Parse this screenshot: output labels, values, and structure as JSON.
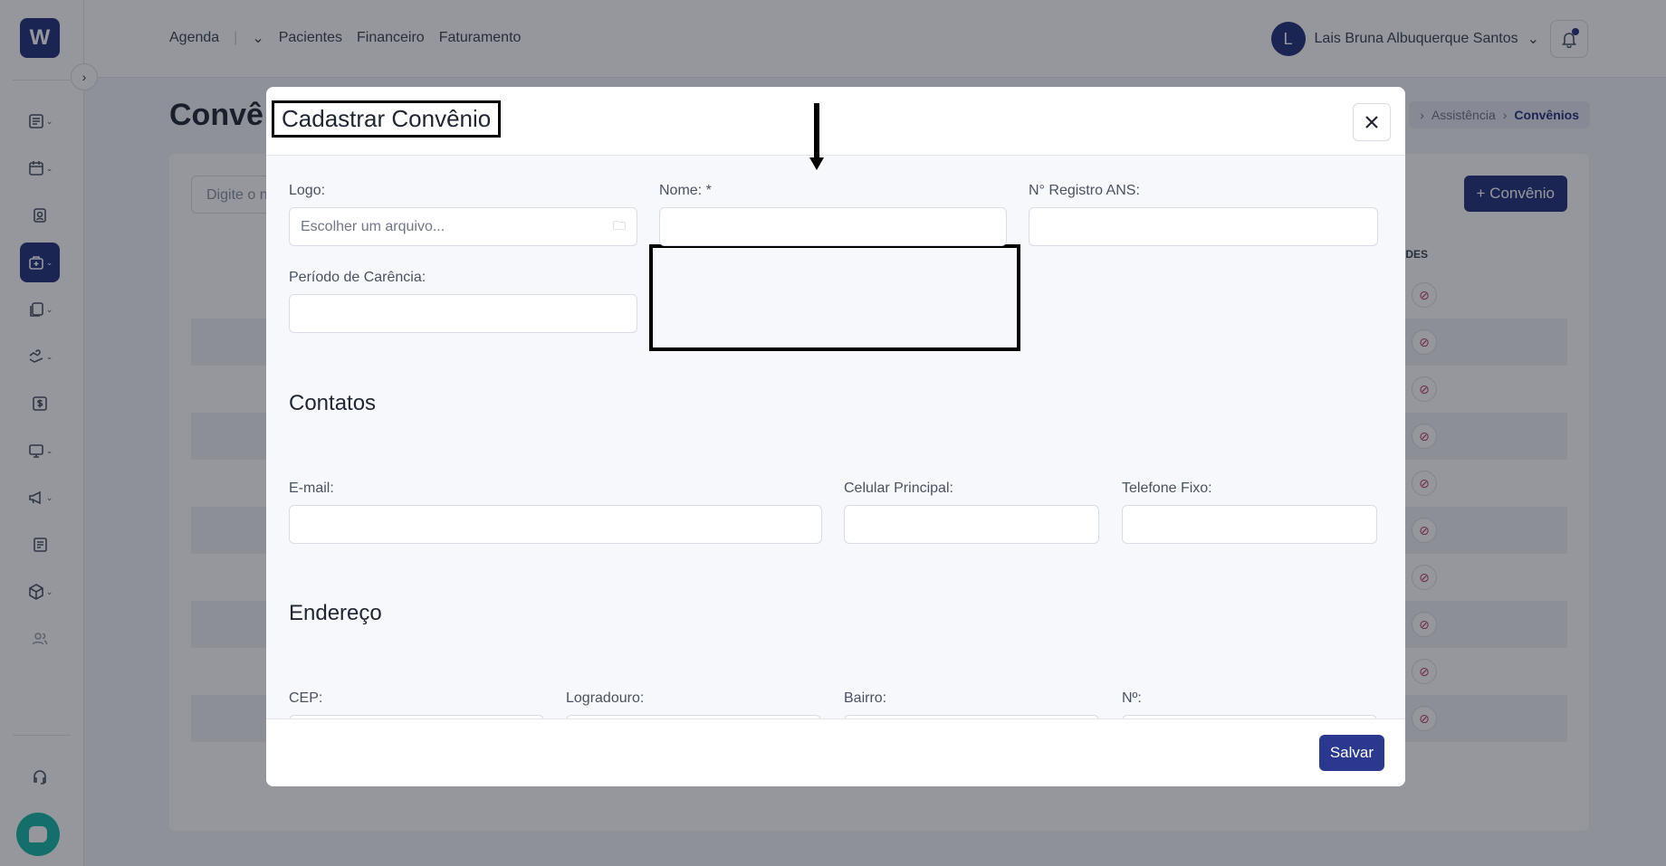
{
  "topnav": {
    "links": [
      "Agenda",
      "Pacientes",
      "Financeiro",
      "Faturamento"
    ],
    "user_name": "Lais Bruna Albuquerque Santos",
    "user_initial": "L"
  },
  "page": {
    "title": "Convê",
    "breadcrumb": [
      "Assistência",
      "Convênios"
    ],
    "search_placeholder": "Digite o n",
    "add_button_label": "+ Convênio",
    "column_header": "DES"
  },
  "modal": {
    "title": "Cadastrar Convênio",
    "fields": {
      "logo": {
        "label": "Logo:",
        "placeholder": "Escolher um arquivo..."
      },
      "nome": {
        "label": "Nome: *",
        "value": ""
      },
      "registro_ans": {
        "label": "N° Registro ANS:",
        "value": ""
      },
      "carencia": {
        "label": "Período de Carência:",
        "value": ""
      },
      "email": {
        "label": "E-mail:",
        "value": ""
      },
      "celular": {
        "label": "Celular Principal:",
        "value": ""
      },
      "telefone": {
        "label": "Telefone Fixo:",
        "value": ""
      },
      "cep": {
        "label": "CEP:",
        "value": ""
      },
      "logradouro": {
        "label": "Logradouro:",
        "value": ""
      },
      "bairro": {
        "label": "Bairro:",
        "value": ""
      },
      "numero": {
        "label": "Nº:",
        "value": ""
      }
    },
    "sections": {
      "contatos": "Contatos",
      "endereco": "Endereço"
    },
    "save_label": "Salvar"
  },
  "colors": {
    "primary": "#21307a",
    "teal": "#14b7a6",
    "danger_icon": "#c03a6a"
  }
}
